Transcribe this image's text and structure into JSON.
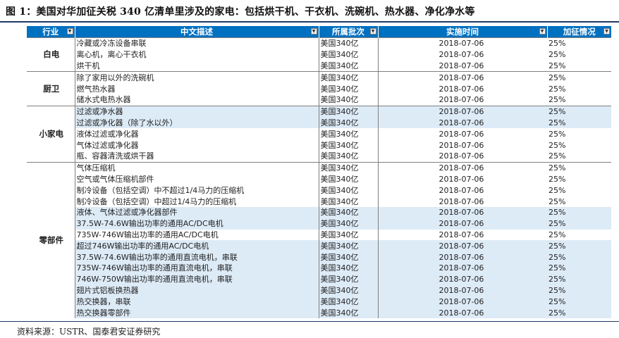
{
  "title": "图 1：美国对华加征关税 340 亿清单里涉及的家电：包括烘干机、干衣机、洗碗机、热水器、净化净水等",
  "headers": {
    "industry": "行业",
    "description": "中文描述",
    "batch": "所属批次",
    "date": "实施时间",
    "rate": "加征情况"
  },
  "filter_icon_glyph": "▼",
  "groups": [
    {
      "category": "白电",
      "rows": [
        {
          "desc": "冷藏或冷冻设备串联",
          "batch": "美国340亿",
          "date": "2018-07-06",
          "rate": "25%",
          "highlight": false
        },
        {
          "desc": "离心机，离心干衣机",
          "batch": "美国340亿",
          "date": "2018-07-06",
          "rate": "25%",
          "highlight": false
        },
        {
          "desc": "烘干机",
          "batch": "美国340亿",
          "date": "2018-07-06",
          "rate": "25%",
          "highlight": false
        }
      ]
    },
    {
      "category": "厨卫",
      "rows": [
        {
          "desc": "除了家用以外的洗碗机",
          "batch": "美国340亿",
          "date": "2018-07-06",
          "rate": "25%",
          "highlight": false
        },
        {
          "desc": "燃气热水器",
          "batch": "美国340亿",
          "date": "2018-07-06",
          "rate": "25%",
          "highlight": false
        },
        {
          "desc": "储水式电热水器",
          "batch": "美国340亿",
          "date": "2018-07-06",
          "rate": "25%",
          "highlight": false
        }
      ]
    },
    {
      "category": "小家电",
      "rows": [
        {
          "desc": "过滤或净水器",
          "batch": "美国340亿",
          "date": "2018-07-06",
          "rate": "25%",
          "highlight": true
        },
        {
          "desc": "过滤或净化器（除了水以外）",
          "batch": "美国340亿",
          "date": "2018-07-06",
          "rate": "25%",
          "highlight": true
        },
        {
          "desc": "液体过滤或净化器",
          "batch": "美国340亿",
          "date": "2018-07-06",
          "rate": "25%",
          "highlight": false
        },
        {
          "desc": "气体过滤或净化器",
          "batch": "美国340亿",
          "date": "2018-07-06",
          "rate": "25%",
          "highlight": false
        },
        {
          "desc": "瓶、容器清洗或烘干器",
          "batch": "美国340亿",
          "date": "2018-07-06",
          "rate": "25%",
          "highlight": false
        }
      ]
    },
    {
      "category": "零部件",
      "rows": [
        {
          "desc": "气体压缩机",
          "batch": "美国340亿",
          "date": "2018-07-06",
          "rate": "25%",
          "highlight": false
        },
        {
          "desc": "空气或气体压缩机部件",
          "batch": "美国340亿",
          "date": "2018-07-06",
          "rate": "25%",
          "highlight": false
        },
        {
          "desc": "制冷设备（包括空调）中不超过1/4马力的压缩机",
          "batch": "美国340亿",
          "date": "2018-07-06",
          "rate": "25%",
          "highlight": false
        },
        {
          "desc": "制冷设备（包括空调）中超过1/4马力的压缩机",
          "batch": "美国340亿",
          "date": "2018-07-06",
          "rate": "25%",
          "highlight": false
        },
        {
          "desc": "液体、气体过滤或净化器部件",
          "batch": "美国340亿",
          "date": "2018-07-06",
          "rate": "25%",
          "highlight": true
        },
        {
          "desc": "37.5W-74.6W输出功率的通用AC/DC电机",
          "batch": "美国340亿",
          "date": "2018-07-06",
          "rate": "25%",
          "highlight": true
        },
        {
          "desc": "735W-746W输出功率的通用AC/DC电机",
          "batch": "美国340亿",
          "date": "2018-07-06",
          "rate": "25%",
          "highlight": false
        },
        {
          "desc": "超过746W输出功率的通用AC/DC电机",
          "batch": "美国340亿",
          "date": "2018-07-06",
          "rate": "25%",
          "highlight": true
        },
        {
          "desc": "37.5W-74.6W输出功率的通用直流电机，串联",
          "batch": "美国340亿",
          "date": "2018-07-06",
          "rate": "25%",
          "highlight": true
        },
        {
          "desc": "735W-746W输出功率的通用直流电机，串联",
          "batch": "美国340亿",
          "date": "2018-07-06",
          "rate": "25%",
          "highlight": true
        },
        {
          "desc": "746W-750W输出功率的通用直流电机，串联",
          "batch": "美国340亿",
          "date": "2018-07-06",
          "rate": "25%",
          "highlight": true
        },
        {
          "desc": "翅片式铝板换热器",
          "batch": "美国340亿",
          "date": "2018-07-06",
          "rate": "25%",
          "highlight": true
        },
        {
          "desc": "热交换器，串联",
          "batch": "美国340亿",
          "date": "2018-07-06",
          "rate": "25%",
          "highlight": true
        },
        {
          "desc": "热交换器零部件",
          "batch": "美国340亿",
          "date": "2018-07-06",
          "rate": "25%",
          "highlight": true
        }
      ]
    }
  ],
  "source": "资料来源：USTR、国泰君安证券研究"
}
